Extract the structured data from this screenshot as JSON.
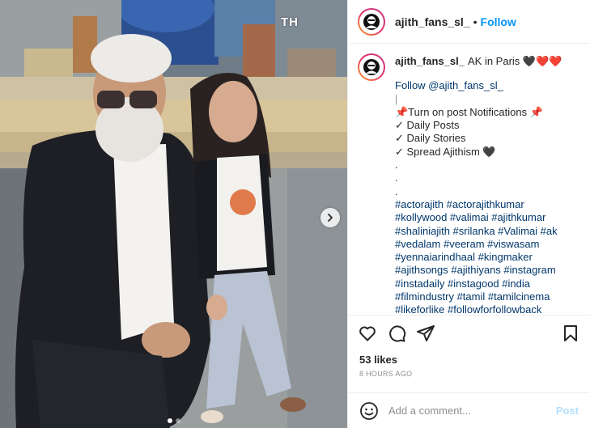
{
  "photo": {
    "watermark": "TH",
    "carousel_count": 2,
    "carousel_active": 1
  },
  "header": {
    "username": "ajith_fans_sl_",
    "separator": "•",
    "follow_label": "Follow"
  },
  "caption": {
    "username": "ajith_fans_sl_",
    "title": "AK in Paris 🖤❤️❤️",
    "lines": [
      "Follow @ajith_fans_sl_",
      "|",
      "📌Turn on post Notifications 📌",
      "✓ Daily Posts",
      "✓ Daily Stories",
      "✓ Spread Ajithism 🖤",
      ".",
      ".",
      "."
    ],
    "hashtags": [
      "#actorajith #actorajithkumar",
      "#kollywood #valimai #ajithkumar",
      "#shaliniajith #srilanka #Valimai #ak",
      "#vedalam #veeram #viswasam",
      "#yennaiarindhaal #kingmaker",
      "#ajithsongs #ajithiyans #instagram",
      "#instadaily #instagood #india",
      "#filmindustry #tamil #tamilcinema",
      "#likeforlike #followforfollowback"
    ]
  },
  "engagement": {
    "likes": "53 likes",
    "time": "8 HOURS AGO"
  },
  "comment_box": {
    "placeholder": "Add a comment...",
    "post_label": "Post"
  },
  "colors": {
    "link": "#00376b",
    "follow": "#0095f6",
    "post_disabled": "#b2dffc"
  }
}
